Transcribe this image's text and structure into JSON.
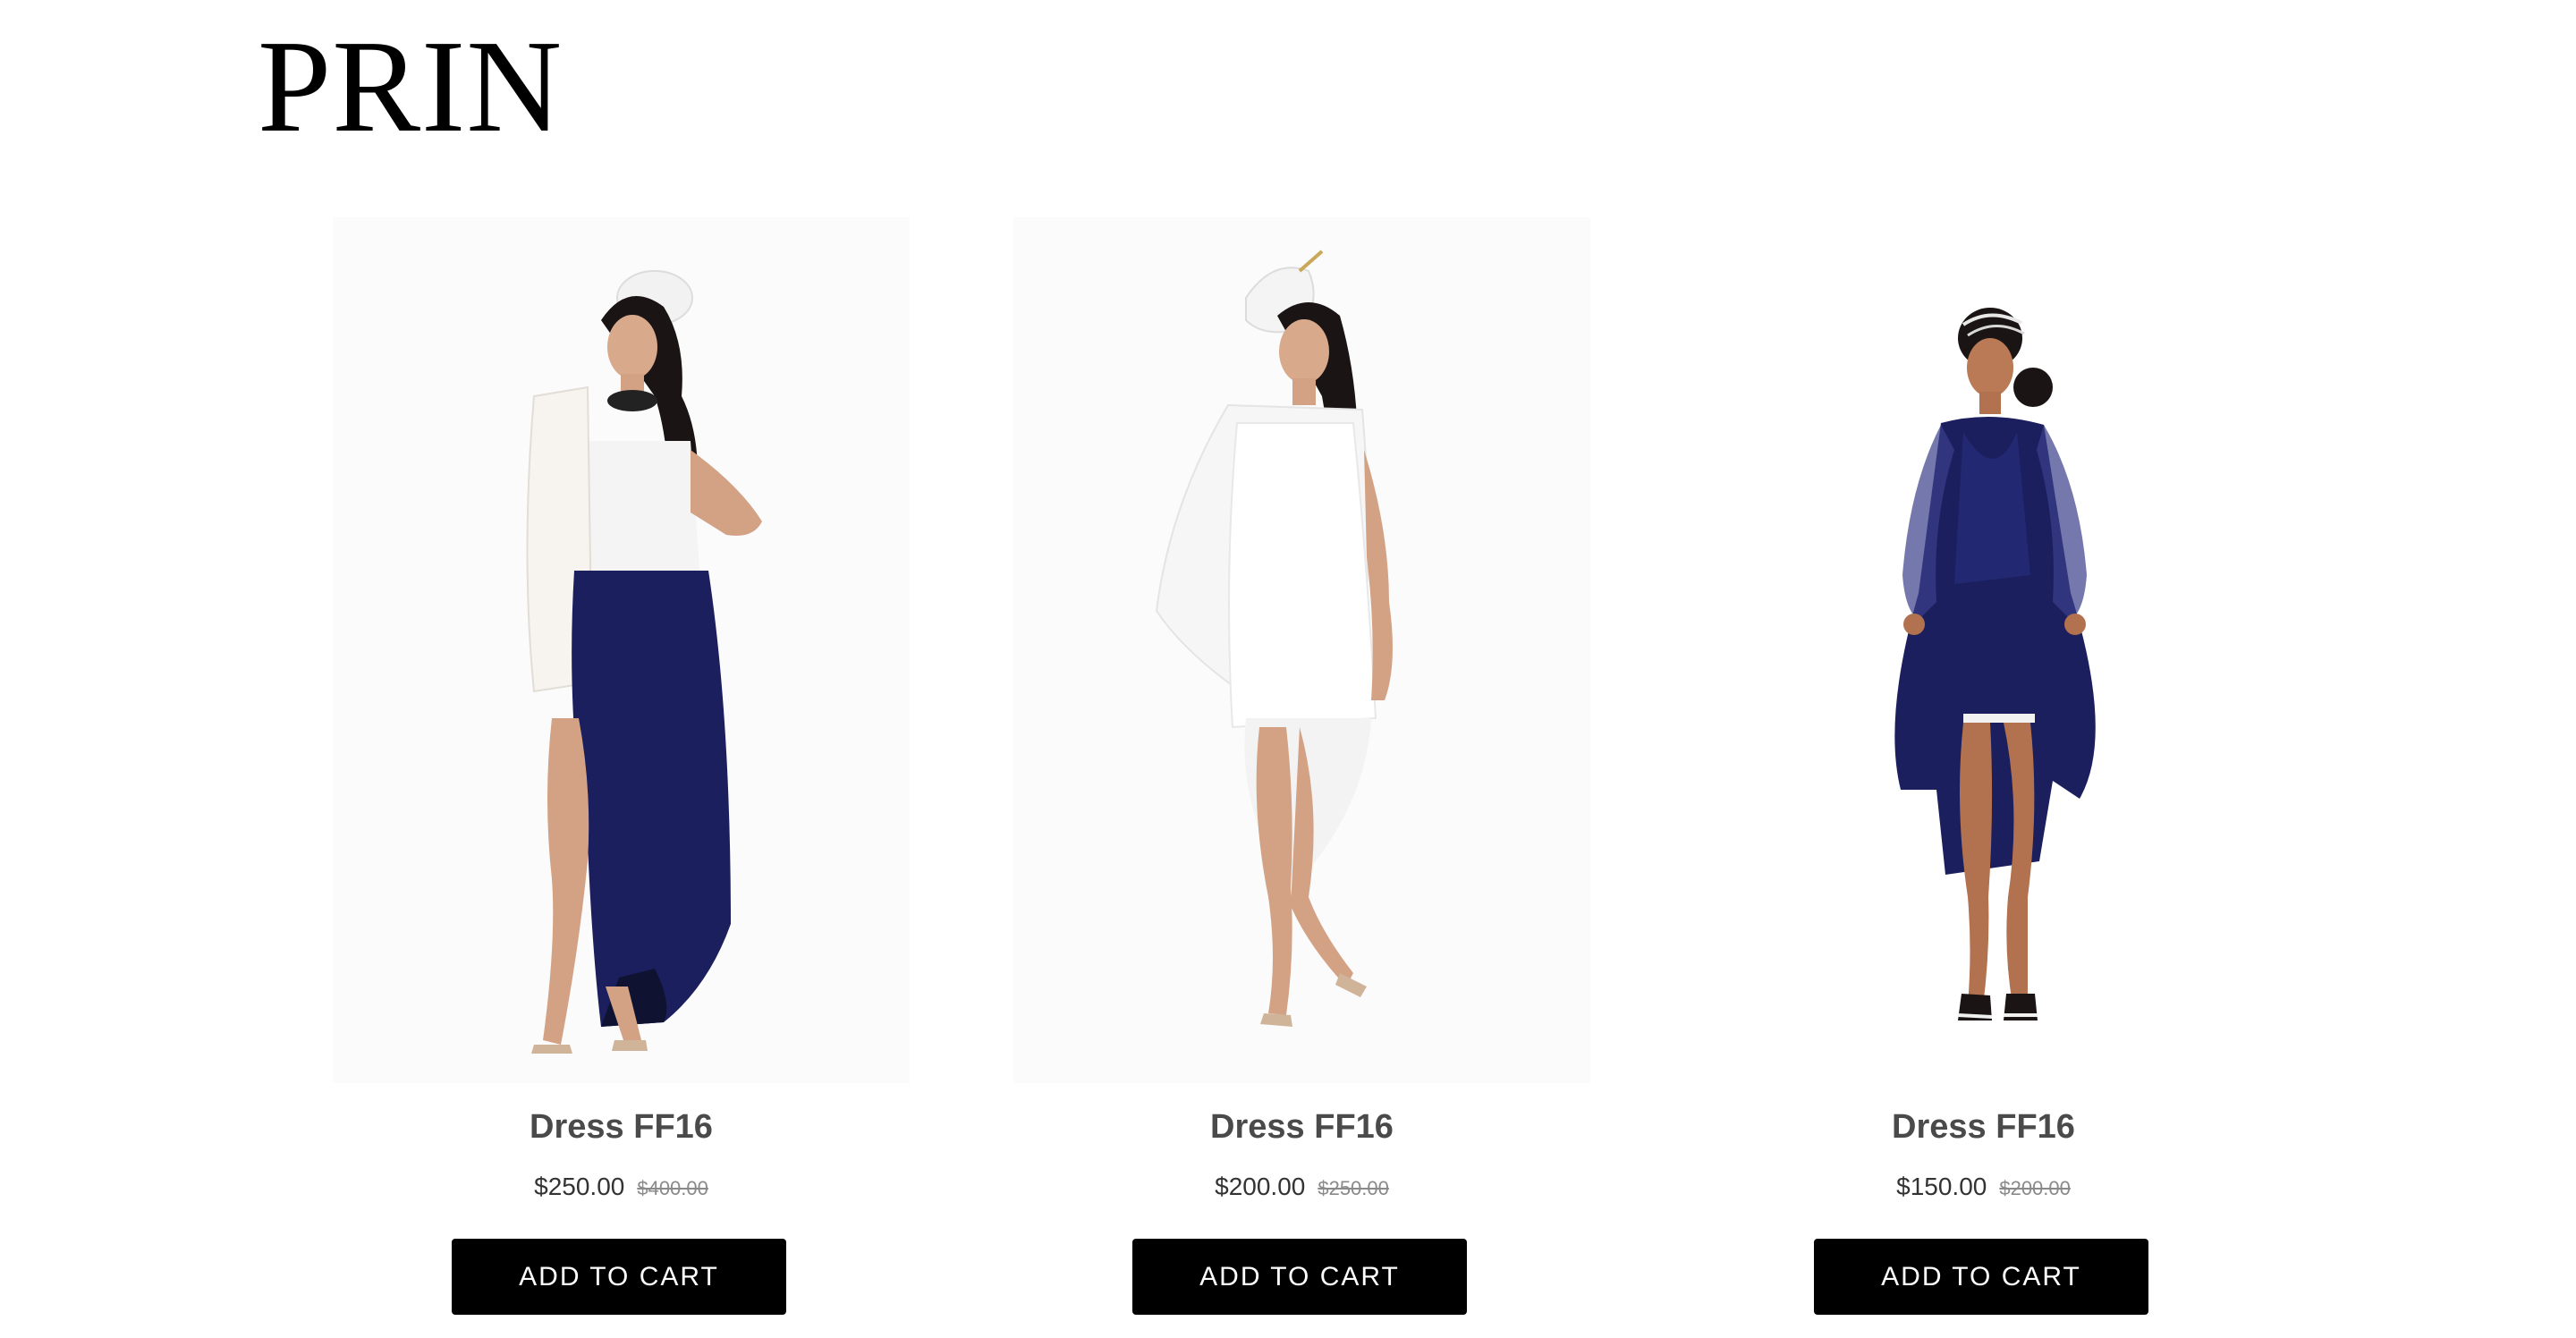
{
  "header": {
    "brand": "PRIN"
  },
  "products": [
    {
      "title": "Dress FF16",
      "price": "$250.00",
      "compare_price": "$400.00",
      "cart_label": "ADD TO CART",
      "image_subject": "model in white top, white fur stole and navy maxi skirt"
    },
    {
      "title": "Dress FF16",
      "price": "$200.00",
      "compare_price": "$250.00",
      "cart_label": "ADD TO CART",
      "image_subject": "model in sheer white cape dress with white fascinator"
    },
    {
      "title": "Dress FF16",
      "price": "$150.00",
      "compare_price": "$200.00",
      "cart_label": "ADD TO CART",
      "image_subject": "model in navy satin dress with sheer sleeves"
    }
  ],
  "colors": {
    "button_bg": "#000000",
    "button_text": "#ffffff",
    "title_text": "#4a4a4a",
    "compare_price_text": "#8a8a8a",
    "navy_fabric": "#1b1f5e"
  }
}
